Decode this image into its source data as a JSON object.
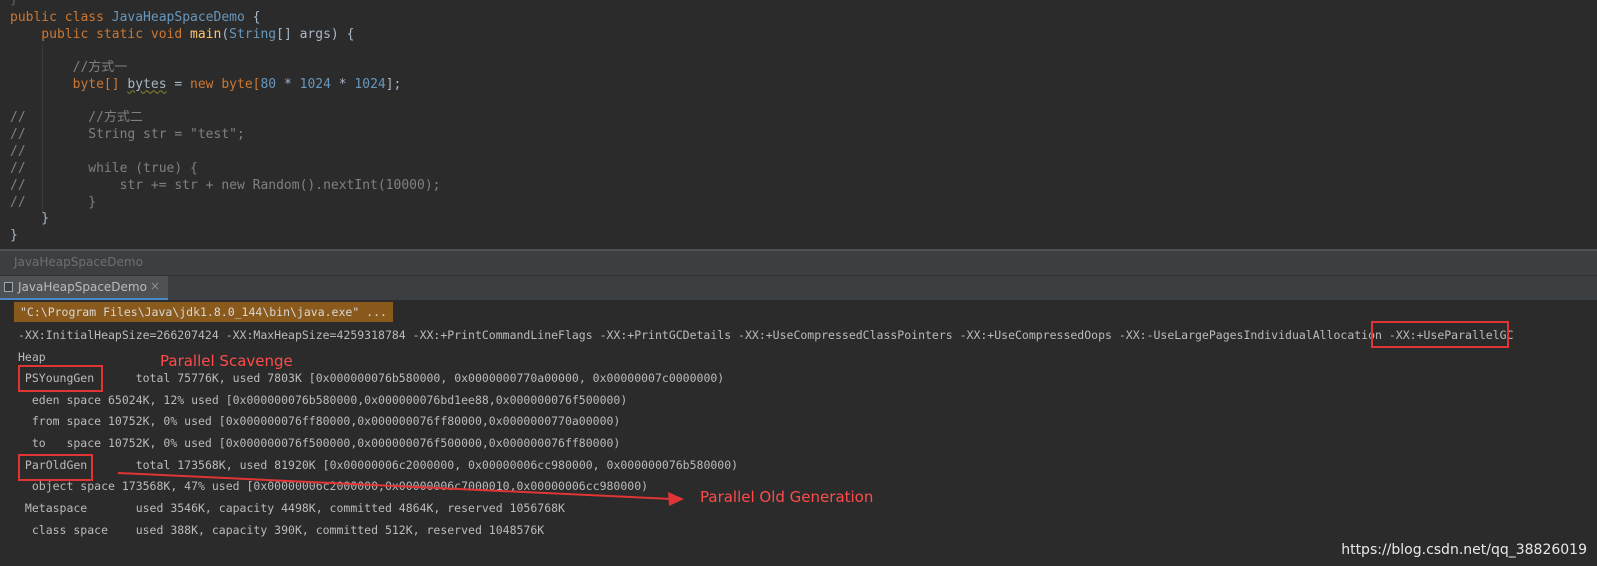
{
  "editor": {
    "line0": "}",
    "line1_a": "public class ",
    "line1_b": "JavaHeapSpaceDemo",
    "line1_c": " {",
    "line2_a": "    public static void ",
    "line2_b": "main",
    "line2_c": "(",
    "line2_d": "String",
    "line2_e": "[] args) {",
    "line3_comment": "        //方式一",
    "line4_a": "        byte[] ",
    "line4_b": "bytes",
    "line4_c": " = ",
    "line4_d": "new",
    "line4_e": " byte[",
    "line4_f": "80",
    "line4_g": " * ",
    "line4_h": "1024",
    "line4_i": " * ",
    "line4_j": "1024",
    "line4_k": "];",
    "line5": "//        //方式二",
    "line6": "//        String str = \"test\";",
    "line7": "//",
    "line8": "//        while (true) {",
    "line9": "//            str += str + new Random().nextInt(10000);",
    "line10": "//        }",
    "line11": "    }",
    "line12": "}"
  },
  "run_panel": {
    "title": "JavaHeapSpaceDemo",
    "tab_label": "JavaHeapSpaceDemo",
    "tab_close": "×"
  },
  "console": {
    "java_cmd": "\"C:\\Program Files\\Java\\jdk1.8.0_144\\bin\\java.exe\" ...",
    "flags": "-XX:InitialHeapSize=266207424 -XX:MaxHeapSize=4259318784 -XX:+PrintCommandLineFlags -XX:+PrintGCDetails -XX:+UseCompressedClassPointers -XX:+UseCompressedOops -XX:-UseLargePagesIndividualAllocation -XX:+UseParallelGC",
    "heap": "Heap",
    "young_label": " PSYoungGen",
    "young_detail": "      total 75776K, used 7803K [0x000000076b580000, 0x0000000770a00000, 0x00000007c0000000)",
    "eden": "  eden space 65024K, 12% used [0x000000076b580000,0x000000076bd1ee88,0x000000076f500000)",
    "from": "  from space 10752K, 0% used [0x000000076ff80000,0x000000076ff80000,0x0000000770a00000)",
    "to": "  to   space 10752K, 0% used [0x000000076f500000,0x000000076f500000,0x000000076ff80000)",
    "old_label": " ParOldGen",
    "old_detail": "       total 173568K, used 81920K [0x00000006c2000000, 0x00000006cc980000, 0x000000076b580000)",
    "object_space": "  object space 173568K, 47% used [0x00000006c2000000,0x00000006c7000010,0x00000006cc980000)",
    "metaspace": " Metaspace       used 3546K, capacity 4498K, committed 4864K, reserved 1056768K",
    "class_space": "  class space    used 388K, capacity 390K, committed 512K, reserved 1048576K"
  },
  "annotations": {
    "parallel_scavenge": "Parallel Scavenge",
    "parallel_old": "Parallel Old Generation"
  },
  "watermark": "https://blog.csdn.net/qq_38826019",
  "colors": {
    "keyword": "#cc7832",
    "function": "#ffc66d",
    "number": "#6897bb",
    "comment": "#808080",
    "annotation_red": "#e03535"
  }
}
